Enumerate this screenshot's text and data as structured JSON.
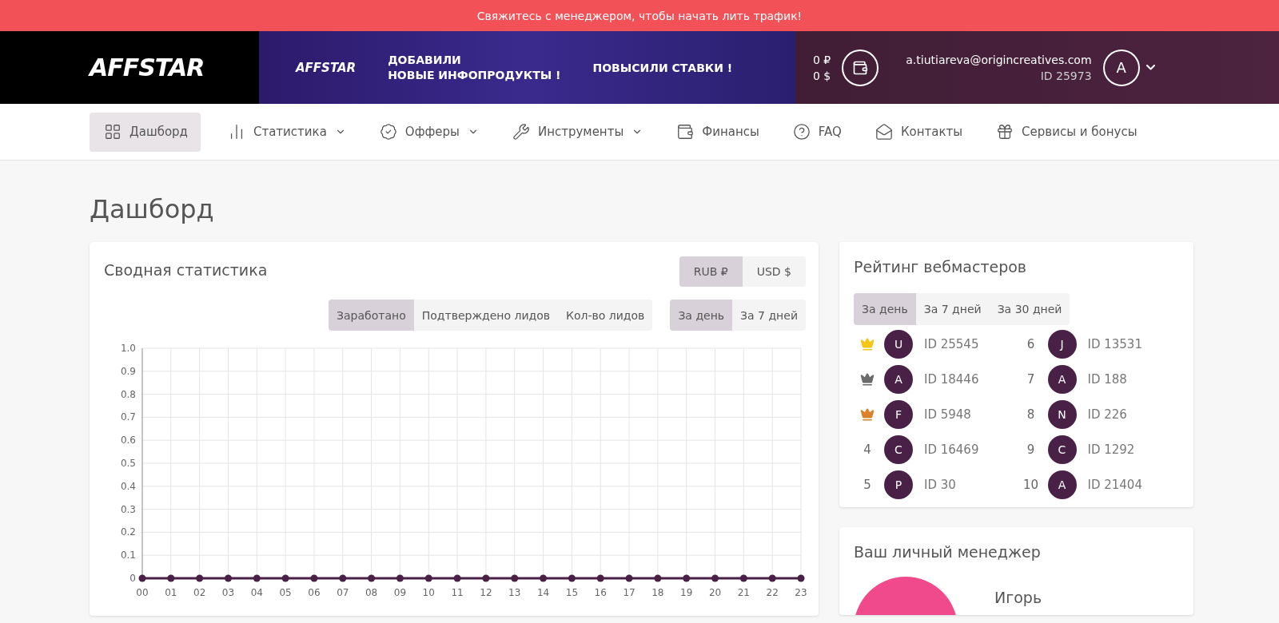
{
  "announcement": "Свяжитесь с менеджером, чтобы начать лить трафик!",
  "header": {
    "logo": "AFFSTAR",
    "banner": {
      "brand": "AFFSTAR",
      "line_1": "ДОБАВИЛИ",
      "line_2": "НОВЫЕ ИНФОПРОДУКТЫ !",
      "line_3": "ПОВЫСИЛИ СТАВКИ !"
    },
    "balance_rub": "0 ₽",
    "balance_usd": "0 $",
    "email": "a.tiutiareva@origincreatives.com",
    "user_id": "ID 25973",
    "avatar": "A"
  },
  "nav": [
    {
      "label": "Дашборд",
      "selected": true,
      "dropdown": false
    },
    {
      "label": "Статистика",
      "selected": false,
      "dropdown": true
    },
    {
      "label": "Офферы",
      "selected": false,
      "dropdown": true
    },
    {
      "label": "Инструменты",
      "selected": false,
      "dropdown": true
    },
    {
      "label": "Финансы",
      "selected": false,
      "dropdown": false
    },
    {
      "label": "FAQ",
      "selected": false,
      "dropdown": false
    },
    {
      "label": "Контакты",
      "selected": false,
      "dropdown": false
    },
    {
      "label": "Сервисы и бонусы",
      "selected": false,
      "dropdown": false
    }
  ],
  "page_title": "Дашборд",
  "summary": {
    "title": "Сводная статистика",
    "currency_tabs": [
      {
        "label": "RUB ₽",
        "selected": true
      },
      {
        "label": "USD $",
        "selected": false
      }
    ],
    "metric_tabs": [
      {
        "label": "Заработано",
        "selected": true
      },
      {
        "label": "Подтверждено лидов",
        "selected": false
      },
      {
        "label": "Кол-во лидов",
        "selected": false
      }
    ],
    "period_tabs": [
      {
        "label": "За день",
        "selected": true
      },
      {
        "label": "За 7 дней",
        "selected": false
      }
    ],
    "chart_data": {
      "type": "line",
      "categories": [
        "00",
        "01",
        "02",
        "03",
        "04",
        "05",
        "06",
        "07",
        "08",
        "09",
        "10",
        "11",
        "12",
        "13",
        "14",
        "15",
        "16",
        "17",
        "18",
        "19",
        "20",
        "21",
        "22",
        "23"
      ],
      "grid": true,
      "series": [
        {
          "color": "#4a2146",
          "marker": true,
          "values": [
            0,
            0,
            0,
            0,
            0,
            0,
            0,
            0,
            0,
            0,
            0,
            0,
            0,
            0,
            0,
            0,
            0,
            0,
            0,
            0,
            0,
            0,
            0,
            0
          ]
        }
      ],
      "ylim": [
        0,
        1
      ],
      "yticks": [
        0,
        0.1,
        0.2,
        0.3,
        0.4,
        0.5,
        0.6,
        0.7,
        0.8,
        0.9,
        {
          "value": 1,
          "label": "1.0"
        }
      ]
    }
  },
  "rating": {
    "title": "Рейтинг вебмастеров",
    "tabs": [
      {
        "label": "За день",
        "selected": true
      },
      {
        "label": "За 7 дней",
        "selected": false
      },
      {
        "label": "За 30 дней",
        "selected": false
      }
    ],
    "entries": [
      {
        "kind": "crown",
        "color": "#f5c518",
        "initial": "U",
        "id": "ID 25545"
      },
      {
        "kind": "crown",
        "color": "#6b6b6b",
        "initial": "A",
        "id": "ID 18446"
      },
      {
        "kind": "crown",
        "color": "#d9822b",
        "initial": "F",
        "id": "ID 5948"
      },
      {
        "kind": "number",
        "rank": "4",
        "initial": "C",
        "id": "ID 16469"
      },
      {
        "kind": "number",
        "rank": "5",
        "initial": "P",
        "id": "ID 30"
      },
      {
        "kind": "number",
        "rank": "6",
        "initial": "J",
        "id": "ID 13531"
      },
      {
        "kind": "number",
        "rank": "7",
        "initial": "A",
        "id": "ID 188"
      },
      {
        "kind": "number",
        "rank": "8",
        "initial": "N",
        "id": "ID 226"
      },
      {
        "kind": "number",
        "rank": "9",
        "initial": "C",
        "id": "ID 1292"
      },
      {
        "kind": "number",
        "rank": "10",
        "initial": "A",
        "id": "ID 21404"
      }
    ]
  },
  "manager": {
    "title": "Ваш личный менеджер",
    "name": "Игорь"
  }
}
